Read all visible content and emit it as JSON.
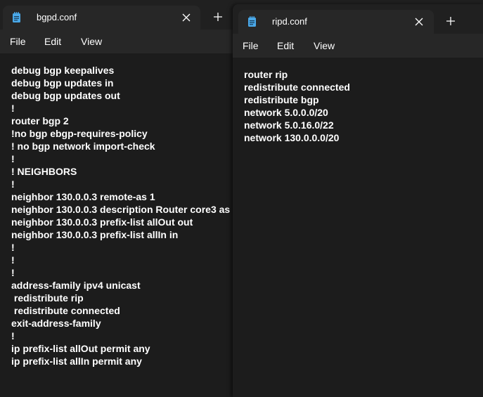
{
  "left_window": {
    "tab_title": "bgpd.conf",
    "close_glyph": "✕",
    "new_tab_glyph": "+",
    "menu": [
      "File",
      "Edit",
      "View"
    ],
    "lines": [
      "debug bgp keepalives",
      "debug bgp updates in",
      "debug bgp updates out",
      "!",
      "router bgp 2",
      "!no bgp ebgp-requires-policy",
      "! no bgp network import-check",
      "!",
      "! NEIGHBORS",
      "!",
      "neighbor 130.0.0.3 remote-as 1",
      "neighbor 130.0.0.3 description Router core3 as",
      "neighbor 130.0.0.3 prefix-list allOut out",
      "neighbor 130.0.0.3 prefix-list allIn in",
      "!",
      "!",
      "!",
      "address-family ipv4 unicast",
      " redistribute rip",
      " redistribute connected",
      "exit-address-family",
      "!",
      "ip prefix-list allOut permit any",
      "ip prefix-list allIn permit any"
    ]
  },
  "right_window": {
    "tab_title": "ripd.conf",
    "close_glyph": "✕",
    "new_tab_glyph": "+",
    "menu": [
      "File",
      "Edit",
      "View"
    ],
    "lines": [
      "router rip",
      "redistribute connected",
      "redistribute bgp",
      "network 5.0.0.0/20",
      "network 5.0.16.0/22",
      "network 130.0.0.0/20"
    ]
  },
  "icons": {
    "tab_icon": "notepad-icon",
    "close_icon": "close-icon",
    "new_tab_icon": "plus-icon"
  },
  "colors": {
    "titlebar": "#202020",
    "tab": "#272727",
    "editor": "#1c1c1c",
    "icon_blue": "#4aa8e8",
    "text": "#ffffff"
  }
}
